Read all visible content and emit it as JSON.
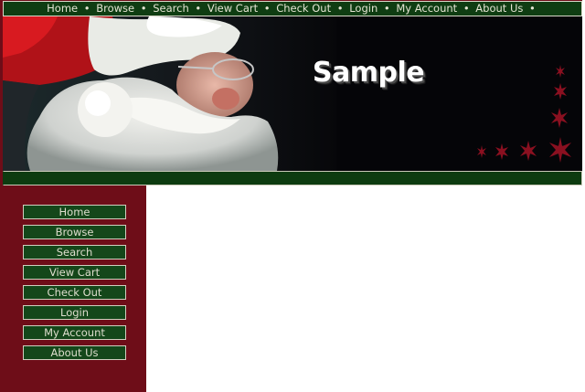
{
  "top_nav": {
    "items": [
      "Home",
      "Browse",
      "Search",
      "View Cart",
      "Check Out",
      "Login",
      "My Account",
      "About Us"
    ],
    "separator": "•"
  },
  "banner": {
    "title": "Sample",
    "image": "santa-claus-photo"
  },
  "sidebar": {
    "items": [
      "Home",
      "Browse",
      "Search",
      "View Cart",
      "Check Out",
      "Login",
      "My Account",
      "About Us"
    ]
  },
  "colors": {
    "nav_green": "#0f3d12",
    "sidebar_maroon": "#6e0d18",
    "snowflake_red": "#8a1020"
  }
}
